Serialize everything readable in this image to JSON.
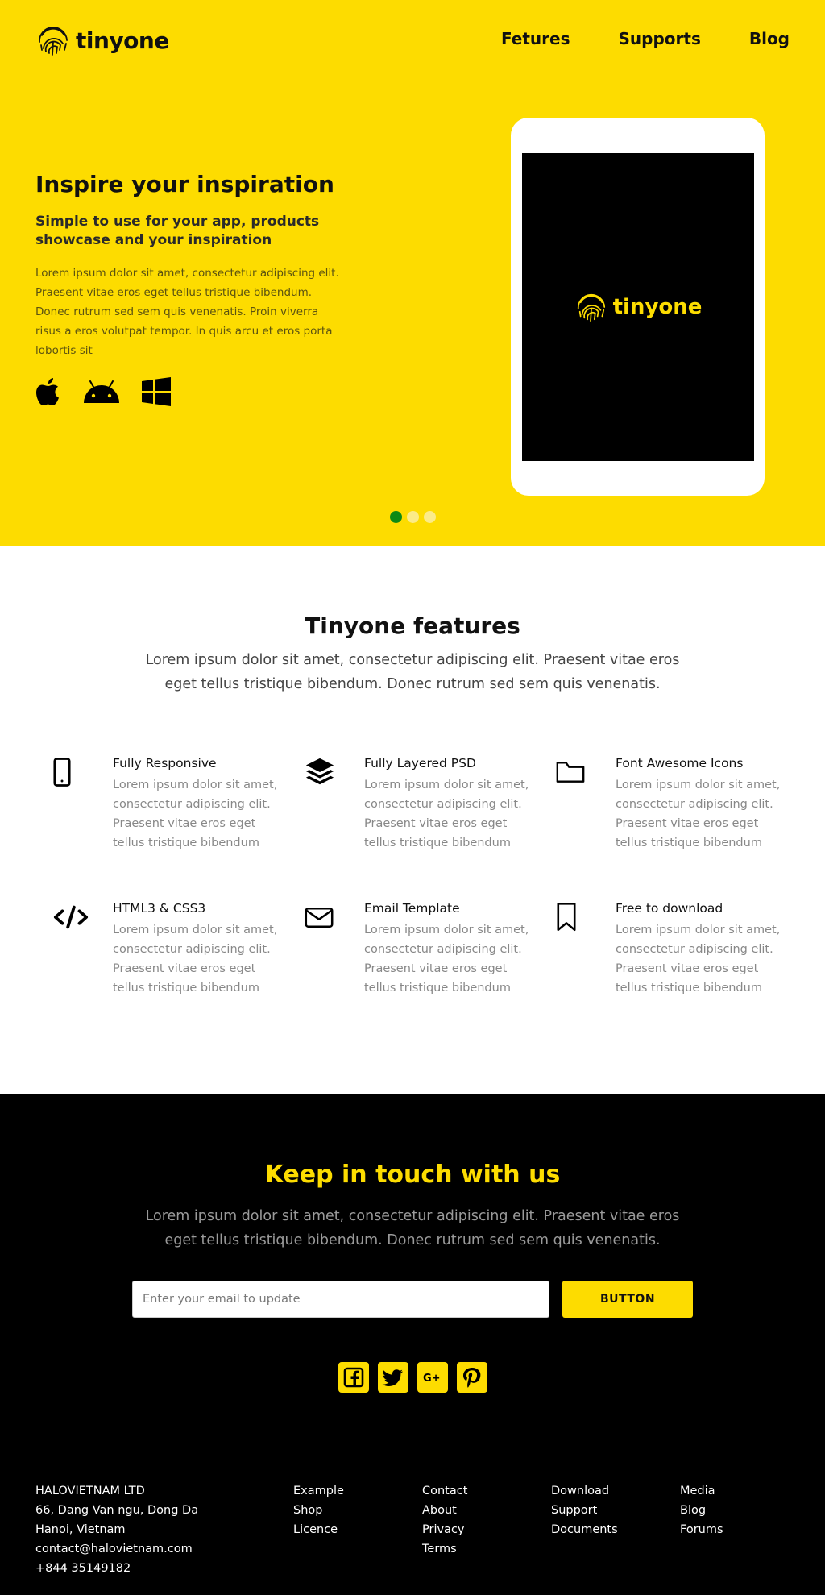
{
  "brand": {
    "name": "tinyone",
    "accent": "#FDDC00",
    "dark": "#000000"
  },
  "nav": {
    "items": [
      "Fetures",
      "Supports",
      "Blog"
    ]
  },
  "hero": {
    "title": "Inspire your inspiration",
    "subtitle": "Simple to use for your app, products showcase and your inspiration",
    "body": "Lorem ipsum dolor sit amet, consectetur adipiscing elit. Praesent vitae eros eget tellus tristique bibendum. Donec rutrum sed sem quis venenatis. Proin viverra risus a eros volutpat tempor. In quis arcu et eros porta lobortis sit",
    "platforms": [
      "apple-icon",
      "android-icon",
      "windows-icon"
    ],
    "device_logo_text": "tinyone",
    "slider": {
      "count": 3,
      "active": 1,
      "active_color": "#0d8a14"
    }
  },
  "features": {
    "title": "Tinyone features",
    "intro": "Lorem ipsum dolor sit amet, consectetur adipiscing elit. Praesent vitae eros eget tellus tristique bibendum. Donec rutrum sed sem quis venenatis.",
    "items": [
      {
        "icon": "mobile-icon",
        "name": "Fully Responsive",
        "desc": "Lorem ipsum dolor sit amet, consectetur adipiscing elit. Praesent vitae eros eget tellus tristique bibendum"
      },
      {
        "icon": "layers-icon",
        "name": "Fully Layered PSD",
        "desc": "Lorem ipsum dolor sit amet, consectetur adipiscing elit. Praesent vitae eros eget tellus tristique bibendum"
      },
      {
        "icon": "folder-icon",
        "name": "Font Awesome Icons",
        "desc": "Lorem ipsum dolor sit amet, consectetur adipiscing elit. Praesent vitae eros eget tellus tristique bibendum"
      },
      {
        "icon": "code-icon",
        "name": "HTML3 & CSS3",
        "desc": "Lorem ipsum dolor sit amet, consectetur adipiscing elit. Praesent vitae eros eget tellus tristique bibendum"
      },
      {
        "icon": "envelope-icon",
        "name": "Email Template",
        "desc": "Lorem ipsum dolor sit amet, consectetur adipiscing elit. Praesent vitae eros eget tellus tristique bibendum"
      },
      {
        "icon": "bookmark-icon",
        "name": "Free to download",
        "desc": "Lorem ipsum dolor sit amet, consectetur adipiscing elit. Praesent vitae eros eget tellus tristique bibendum"
      }
    ]
  },
  "contact": {
    "title": "Keep in touch with us",
    "intro": "Lorem ipsum dolor sit amet, consectetur adipiscing elit. Praesent vitae eros eget tellus tristique bibendum. Donec rutrum sed sem quis venenatis.",
    "email_placeholder": "Enter your email to update",
    "email_value": "",
    "button_label": "BUTTON",
    "social": [
      "facebook-icon",
      "twitter-icon",
      "google-plus-icon",
      "pinterest-icon"
    ]
  },
  "footer": {
    "company": [
      "HALOVIETNAM LTD",
      "66, Dang Van ngu, Dong Da",
      "Hanoi, Vietnam",
      "contact@halovietnam.com",
      "+844 35149182"
    ],
    "col1": [
      "Example",
      "Shop",
      "Licence"
    ],
    "col2": [
      "Contact",
      "About",
      "Privacy",
      "Terms"
    ],
    "col3": [
      "Download",
      "Support",
      "Documents"
    ],
    "col4": [
      "Media",
      "Blog",
      "Forums"
    ]
  }
}
